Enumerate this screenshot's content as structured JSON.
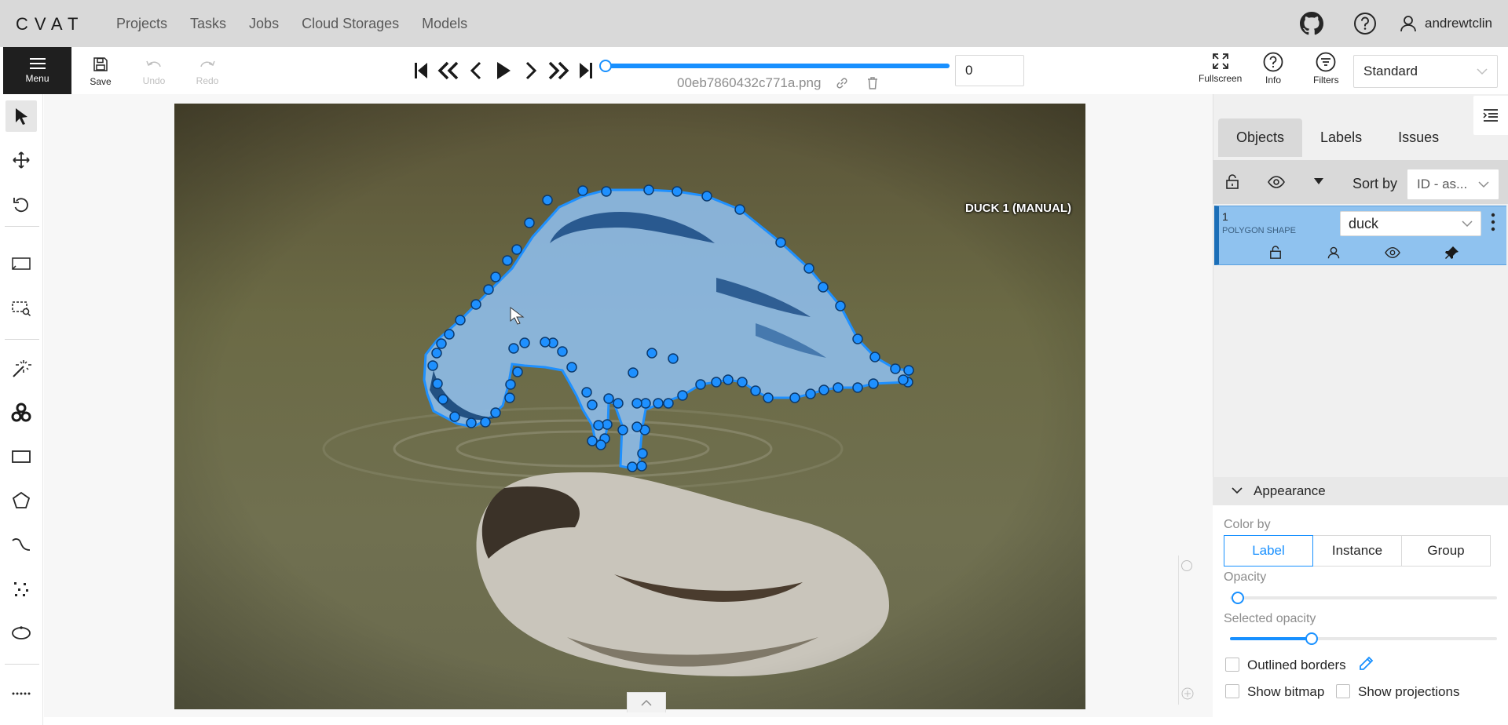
{
  "header": {
    "logo": "CVAT",
    "nav": [
      "Projects",
      "Tasks",
      "Jobs",
      "Cloud Storages",
      "Models"
    ],
    "username": "andrewtclin"
  },
  "toolbar": {
    "menu_label": "Menu",
    "save_label": "Save",
    "undo_label": "Undo",
    "redo_label": "Redo",
    "filename": "00eb7860432c771a.png",
    "frame_value": "0",
    "fullscreen_label": "Fullscreen",
    "info_label": "Info",
    "filters_label": "Filters",
    "workspace": "Standard"
  },
  "canvas": {
    "shape_label": "DUCK 1 (MANUAL)",
    "polygon_color": "#1e90ff"
  },
  "right_panel": {
    "tabs": [
      "Objects",
      "Labels",
      "Issues"
    ],
    "sort_by_label": "Sort by",
    "sort_by_value": "ID - as...",
    "object": {
      "id": "1",
      "type": "POLYGON SHAPE",
      "label": "duck"
    },
    "appearance": {
      "title": "Appearance",
      "color_by_label": "Color by",
      "color_by_options": [
        "Label",
        "Instance",
        "Group"
      ],
      "color_by_selected": "Label",
      "opacity_label": "Opacity",
      "opacity": 0,
      "selected_opacity_label": "Selected opacity",
      "selected_opacity": 0.4,
      "outlined_borders_label": "Outlined borders",
      "show_bitmap_label": "Show bitmap",
      "show_projections_label": "Show projections"
    }
  }
}
